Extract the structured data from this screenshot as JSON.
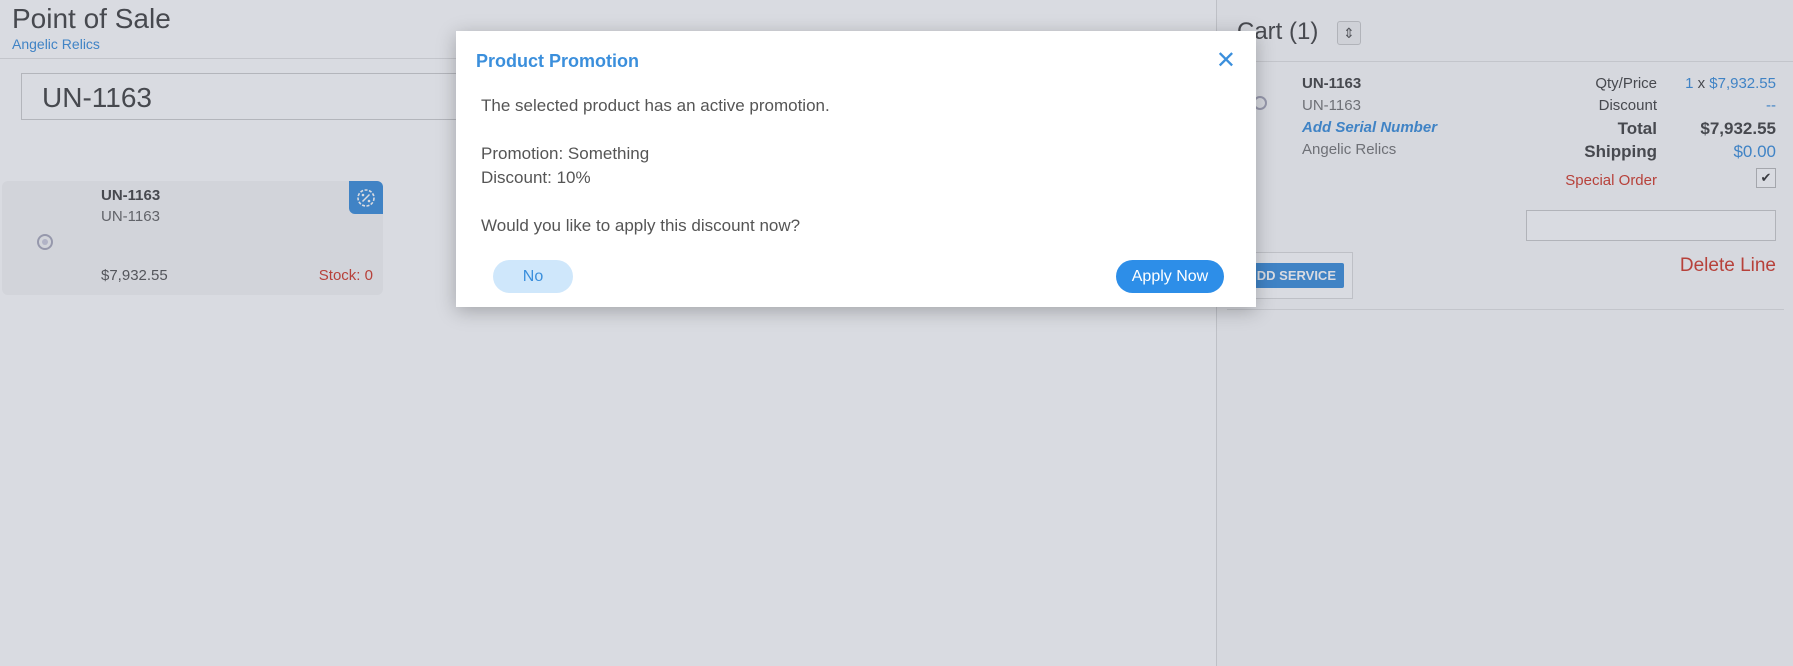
{
  "header": {
    "title": "Point of Sale",
    "store": "Angelic Relics"
  },
  "search": {
    "value": "UN-1163"
  },
  "product_card": {
    "name": "UN-1163",
    "code": "UN-1163",
    "price": "$7,932.55",
    "stock": "Stock: 0",
    "thumb_icon": "jewelry-icon",
    "promo_icon": "discount-badge-icon"
  },
  "cart": {
    "title": "Cart (1)",
    "item": {
      "name": "UN-1163",
      "code": "UN-1163",
      "serial_link": "Add Serial Number",
      "vendor": "Angelic Relics",
      "qty_label": "Qty/Price",
      "qty": "1",
      "qty_sep": "x",
      "price": "$7,932.55",
      "discount_label": "Discount",
      "discount_value": "--",
      "total_label": "Total",
      "total_value": "$7,932.55",
      "shipping_label": "Shipping",
      "shipping_value": "$0.00",
      "special_order_label": "Special Order",
      "special_order_checked": true,
      "notes_value": ""
    },
    "add_service_label": "DD SERVICE",
    "delete_line_label": "Delete Line"
  },
  "modal": {
    "title": "Product Promotion",
    "line1": "The selected product has an active promotion.",
    "promotion": "Promotion: Something",
    "discount": "Discount: 10%",
    "question": "Would you like to apply this discount now?",
    "no_label": "No",
    "apply_label": "Apply Now"
  },
  "colors": {
    "accent": "#3b8fdc",
    "danger": "#d43a2a",
    "overlay": "rgba(80,90,120,0.22)"
  }
}
